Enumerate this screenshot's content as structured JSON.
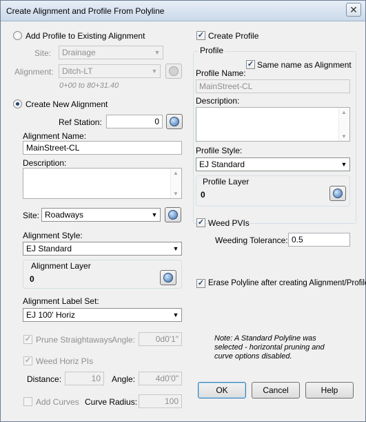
{
  "window": {
    "title": "Create Alignment and Profile From Polyline",
    "close_glyph": "✕"
  },
  "left": {
    "add_profile_label": "Add Profile to Existing Alignment",
    "site_label": "Site:",
    "site_value": "Drainage",
    "alignment_label": "Alignment:",
    "alignment_value": "Ditch-LT",
    "station_range": "0+00 to 80+31.40",
    "create_alignment_label": "Create New Alignment",
    "ref_station_label": "Ref Station:",
    "ref_station_value": "0",
    "alignment_name_label": "Alignment Name:",
    "alignment_name_value": "MainStreet-CL",
    "description_label": "Description:",
    "site2_label": "Site:",
    "site2_value": "Roadways",
    "alignment_style_label": "Alignment Style:",
    "alignment_style_value": "EJ Standard",
    "alignment_layer_label": "Alignment Layer",
    "alignment_layer_value": "0",
    "label_set_label": "Alignment Label Set:",
    "label_set_value": "EJ 100' Horiz",
    "prune_label": "Prune Straightaways",
    "angle_label": "Angle:",
    "prune_angle_value": "0d0'1\"",
    "weed_label": "Weed Horiz PIs",
    "distance_label": "Distance:",
    "distance_value": "10",
    "angle2_label": "Angle:",
    "weed_angle_value": "4d0'0\"",
    "add_curves_label": "Add Curves",
    "curve_radius_label": "Curve Radius:",
    "curve_radius_value": "100"
  },
  "right": {
    "create_profile_label": "Create Profile",
    "profile_group_label": "Profile",
    "same_name_label": "Same name as Alignment",
    "profile_name_label": "Profile Name:",
    "profile_name_value": "MainStreet-CL",
    "description_label": "Description:",
    "profile_style_label": "Profile Style:",
    "profile_style_value": "EJ Standard",
    "profile_layer_label": "Profile Layer",
    "profile_layer_value": "0",
    "weed_pvis_label": "Weed PVIs",
    "weeding_tolerance_label": "Weeding Tolerance:",
    "weeding_tolerance_value": "0.5",
    "erase_label": "Erase Polyline after creating Alignment/Profile",
    "note": "Note: A Standard Polyline was selected - horizontal pruning and curve options disabled."
  },
  "buttons": {
    "ok": "OK",
    "cancel": "Cancel",
    "help": "Help"
  },
  "glyphs": {
    "check": "✓",
    "arrow_down": "▼",
    "scroll_up": "▲",
    "scroll_down": "▼"
  }
}
